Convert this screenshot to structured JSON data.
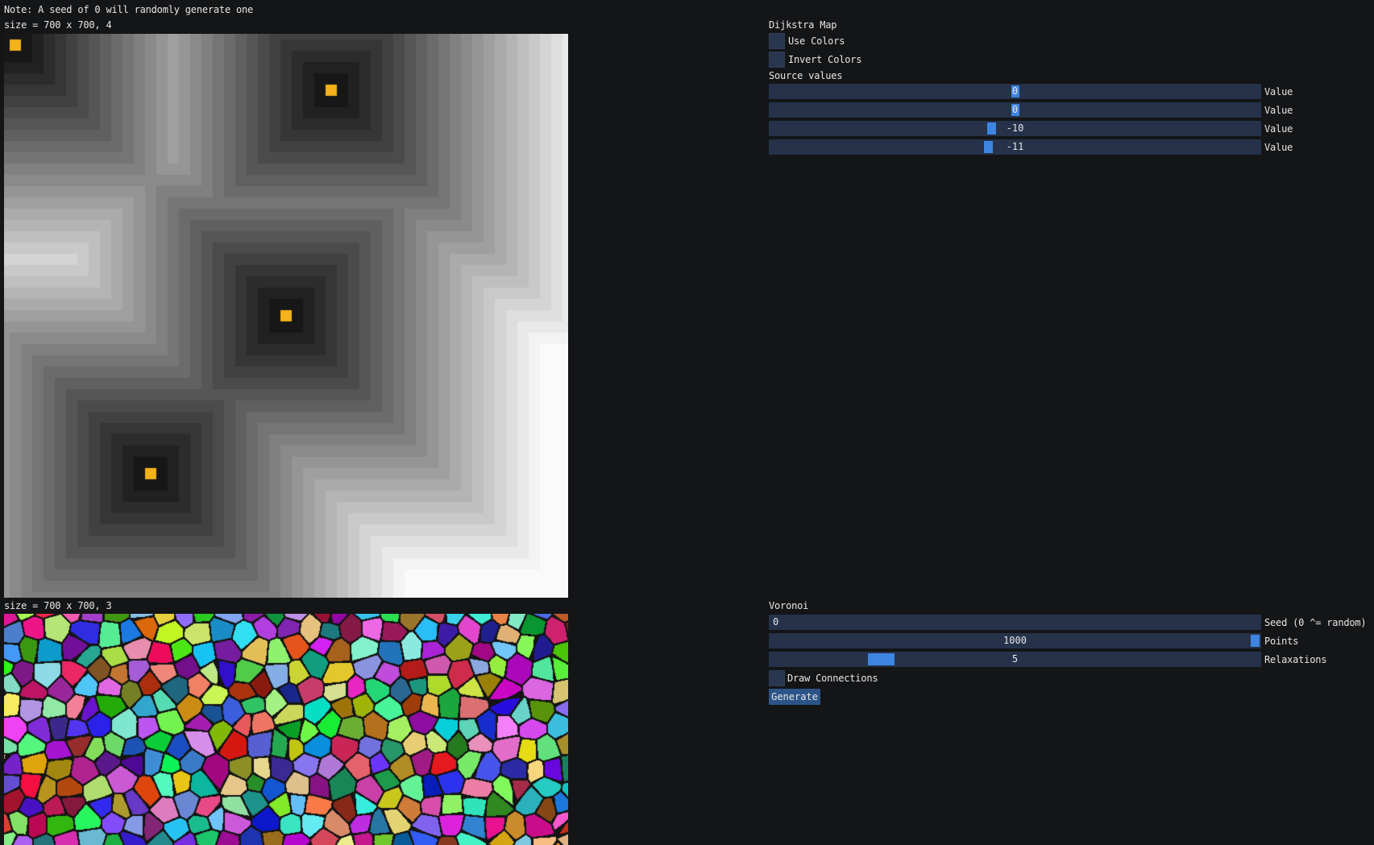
{
  "top_note": "Note: A seed of 0 will randomly generate one",
  "dijkstra_view": {
    "size_label": "size = 700 x 700, 4",
    "cells": 25,
    "sources": [
      {
        "col": 0,
        "row": 0
      },
      {
        "col": 14,
        "row": 2
      },
      {
        "col": 12,
        "row": 12
      },
      {
        "col": 6,
        "row": 19
      }
    ],
    "source_color": "#f5b21a"
  },
  "voronoi_view": {
    "size_label": "size = 700 x 700, 3"
  },
  "dijkstra_panel": {
    "title": "Dijkstra Map",
    "use_colors_label": "Use Colors",
    "use_colors": false,
    "invert_colors_label": "Invert Colors",
    "invert_colors": false,
    "source_values_label": "Source values",
    "sliders": [
      {
        "value": "0",
        "label": "Value"
      },
      {
        "value": "0",
        "label": "Value"
      },
      {
        "value": "-10",
        "label": "Value"
      },
      {
        "value": "-11",
        "label": "Value"
      }
    ]
  },
  "voronoi_panel": {
    "title": "Voronoi",
    "seed_value": "0",
    "seed_label": "Seed (0 ^= random)",
    "points_value": "1000",
    "points_label": "Points",
    "relaxations_value": "5",
    "relaxations_label": "Relaxations",
    "draw_connections_label": "Draw Connections",
    "draw_connections": false,
    "generate_label": "Generate"
  },
  "colors": {
    "background": "#141517",
    "widget_bg": "#25324a",
    "slider_grab": "#3d85e0",
    "button": "#2c5488",
    "source_marker": "#f5b21a"
  }
}
